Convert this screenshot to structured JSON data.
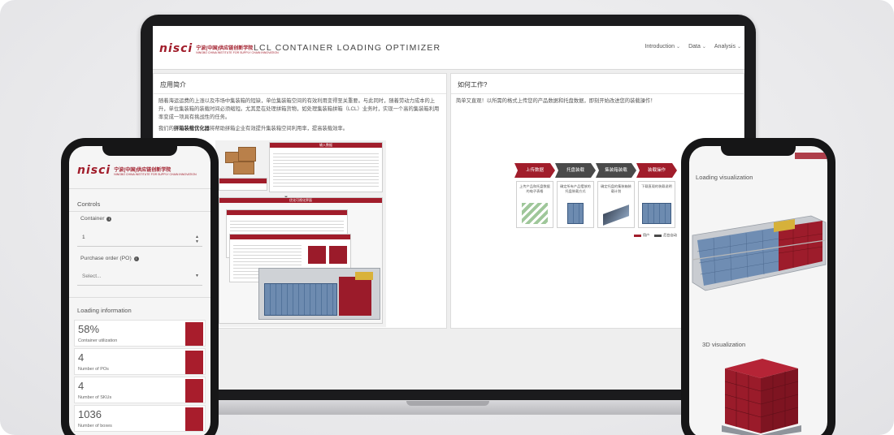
{
  "colors": {
    "brand": "#a11d2b",
    "accent_blue": "#6d8bb0",
    "muted_bg": "#eeeeee"
  },
  "laptop": {
    "logo": {
      "mark": "nisci",
      "cn": "宁波(中国)供应链创新学院",
      "en": "NINGBO CHINA INSTITUTE FOR SUPPLY CHAIN INNOVATION"
    },
    "app_title": "LCL CONTAINER LOADING OPTIMIZER",
    "nav": [
      {
        "label": "Introduction",
        "icon": "chevron-down-icon"
      },
      {
        "label": "Data",
        "icon": "chevron-down-icon"
      },
      {
        "label": "Analysis",
        "icon": "chevron-down-icon"
      }
    ],
    "intro_card": {
      "title": "应用简介",
      "para1": "随着海运运费的上涨以及市场中集装箱的短缺，单位集装箱空间的有效利用变得至关重要。与此同时，随着劳动力成本的上升，单位集装箱的装载时间必须缩短。尤其是在处理拼箱货物，如处理集装箱拼箱（LCL）业务时，实现一个高的集装箱利用率变成一项具有挑战性的任务。",
      "para2_prefix": "我们的",
      "para2_bold": "拼箱装载优化器",
      "para2_suffix": "将帮助拼箱企业有效提升集装箱空间利用率，提高装载效率。",
      "illustration": {
        "sheet1_title": "输入数据",
        "sheet2_title": "优化可视化界面"
      }
    },
    "how_card": {
      "title": "如何工作?",
      "para": "简单又直观！以所需的格式上传您的产品数据和托盘数据，即刻开始改进您的装载操作！",
      "steps": [
        {
          "label": "上传数据",
          "desc": "上传产品和托盘数据的电子表格"
        },
        {
          "label": "托盘装载",
          "desc": "确定所有产品摆放的托盘装载方式"
        },
        {
          "label": "集装箱装载",
          "desc": "确定托盘的集装箱装载计划"
        },
        {
          "label": "装载操作",
          "desc": "下载直观的装载说明"
        }
      ],
      "legend": [
        {
          "label": "用户"
        },
        {
          "label": "后台自动"
        }
      ]
    }
  },
  "phone_left": {
    "logo": {
      "mark": "nisci",
      "cn": "宁波(中国)供应链创新学院",
      "en": "NINGBO CHINA INSTITUTE FOR SUPPLY CHAIN INNOVATION"
    },
    "controls_title": "Controls",
    "container": {
      "label": "Container",
      "value": "1"
    },
    "po": {
      "label": "Purchase order (PO)",
      "placeholder": "Select..."
    },
    "loading_title": "Loading information",
    "metrics": [
      {
        "value": "58%",
        "label": "Container utilization"
      },
      {
        "value": "4",
        "label": "Number of POs"
      },
      {
        "value": "4",
        "label": "Number of SKUs"
      },
      {
        "value": "1036",
        "label": "Number of boxes"
      }
    ]
  },
  "phone_right": {
    "loading_viz_title": "Loading visualization",
    "viz3d_title": "3D visualization"
  }
}
